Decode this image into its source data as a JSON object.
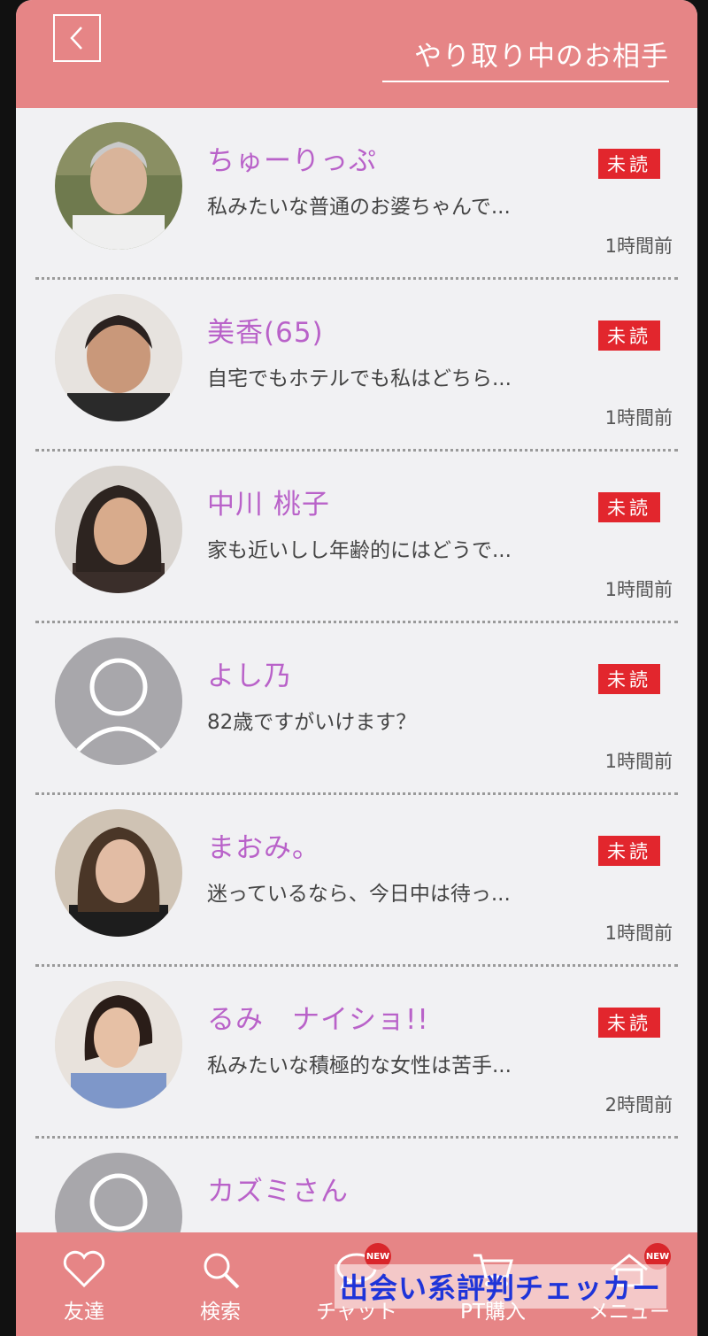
{
  "header": {
    "title": "やり取り中のお相手"
  },
  "conversations": [
    {
      "name": "ちゅーりっぷ",
      "badge": "未読",
      "message": "私みたいな普通のお婆ちゃんで...",
      "time": "1時間前",
      "avatar": "photo"
    },
    {
      "name": "美香(65)",
      "badge": "未読",
      "message": "自宅でもホテルでも私はどちら...",
      "time": "1時間前",
      "avatar": "photo"
    },
    {
      "name": "中川 桃子",
      "badge": "未読",
      "message": "家も近いしし年齢的にはどうで...",
      "time": "1時間前",
      "avatar": "photo"
    },
    {
      "name": "よし乃",
      "badge": "未読",
      "message": "82歳ですがいけます？",
      "time": "1時間前",
      "avatar": "default"
    },
    {
      "name": "まおみ。",
      "badge": "未読",
      "message": "迷っているなら、今日中は待っ...",
      "time": "1時間前",
      "avatar": "photo"
    },
    {
      "name": "るみ　ナイショ!!",
      "badge": "未読",
      "message": "私みたいな積極的な女性は苦手...",
      "time": "2時間前",
      "avatar": "photo"
    },
    {
      "name": "カズミさん",
      "badge": "",
      "message": "",
      "time": "",
      "avatar": "default"
    }
  ],
  "nav": [
    {
      "label": "友達",
      "icon": "heart-icon",
      "new": ""
    },
    {
      "label": "検索",
      "icon": "search-icon",
      "new": ""
    },
    {
      "label": "チャット",
      "icon": "chat-icon",
      "new": "NEW"
    },
    {
      "label": "PT購入",
      "icon": "cart-icon",
      "new": ""
    },
    {
      "label": "メニュー",
      "icon": "menu-icon",
      "new": "NEW"
    }
  ],
  "watermark": "出会い系評判チェッカー",
  "colors": {
    "header": "#e68586",
    "name": "#b962c9",
    "badge": "#e2262d"
  }
}
